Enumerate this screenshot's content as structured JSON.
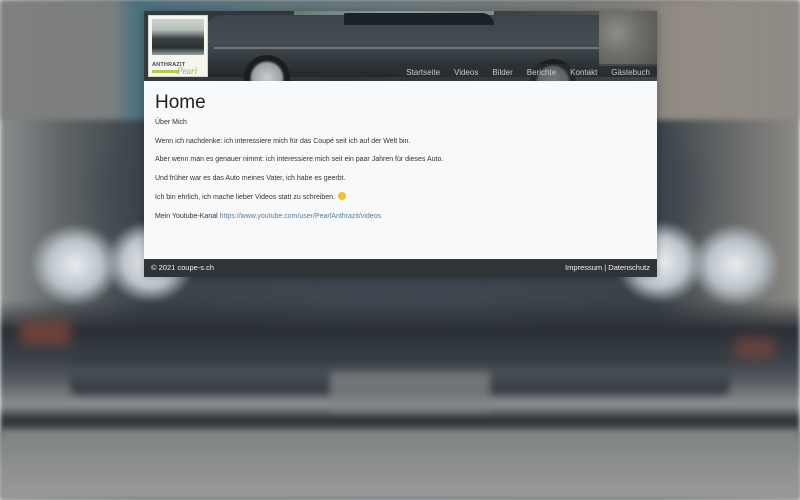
{
  "nav": {
    "items": [
      "Startseite",
      "Videos",
      "Bilder",
      "Berichte",
      "Kontakt",
      "Gästebuch"
    ]
  },
  "logo": {
    "text": "ANTHRAZIT",
    "script": "Pearl"
  },
  "content": {
    "title": "Home",
    "subtitle": "Über Mich",
    "paragraphs": [
      "Wenn ich nachdenke: ich interessiere mich für das Coupé seit ich auf der Welt bin.",
      "Aber wenn man es genauer nimmt: ich interessiere mich seit ein paar Jahren für dieses Auto.",
      "Und früher war es das Auto meines Vater, ich habe es geerbt.",
      "Ich bin ehrlich, ich mache lieber Videos statt zu schreiben."
    ],
    "youtube_label": "Mein Youtube-Kanal",
    "youtube_link": "https://www.youtube.com/user/PearlAnthrazit/videos"
  },
  "footer": {
    "copyright": "© 2021 coupe-s.ch",
    "impressum": "Impressum",
    "separator": "|",
    "datenschutz": "Datenschutz"
  },
  "colors": {
    "link": "#5a7b9a",
    "footer_bg": "#2f3439",
    "content_bg": "#f8f9fa",
    "logo_accent": "#9bb235"
  }
}
